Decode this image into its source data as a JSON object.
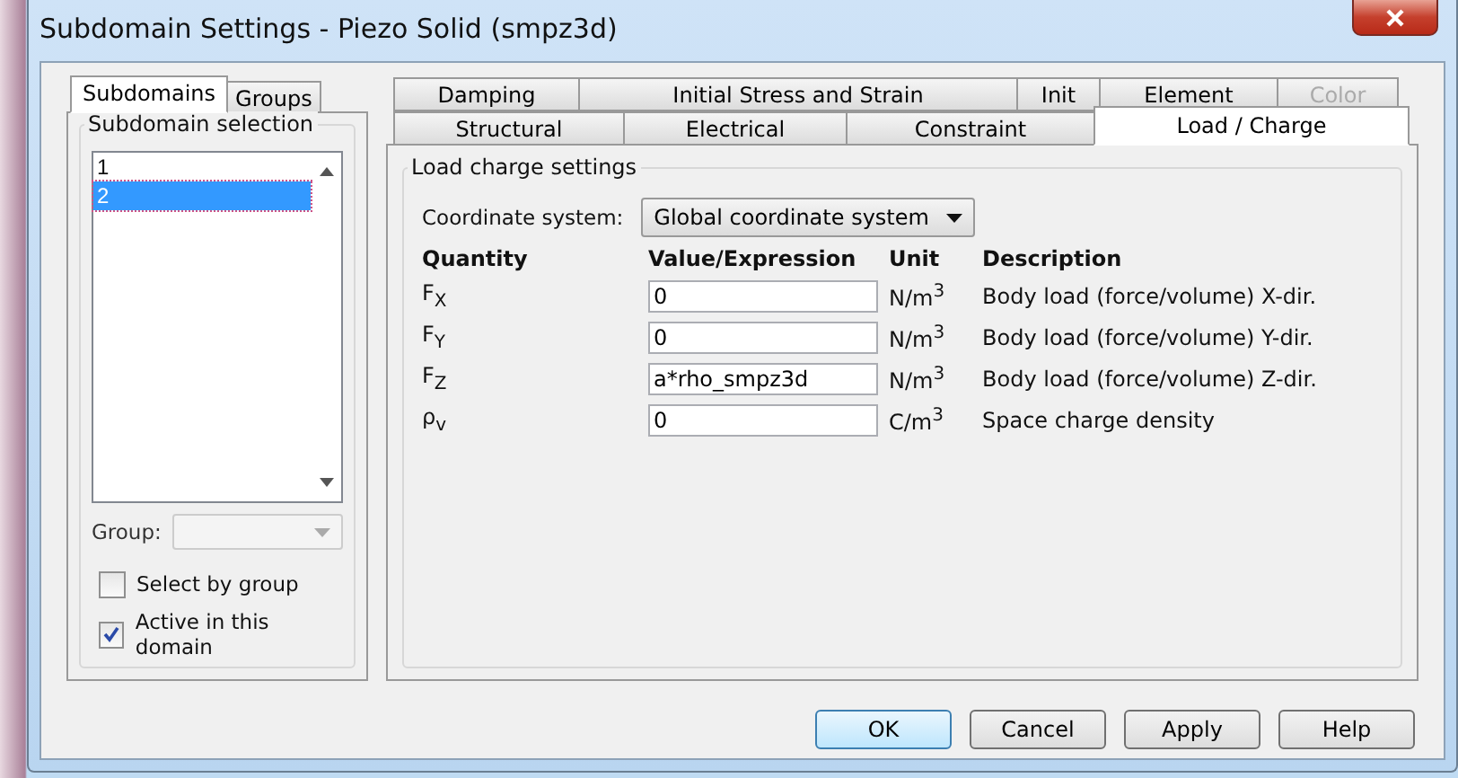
{
  "window": {
    "title": "Subdomain Settings - Piezo Solid (smpz3d)"
  },
  "left_tabs": [
    {
      "label": "Subdomains",
      "selected": true
    },
    {
      "label": "Groups",
      "selected": false
    }
  ],
  "subdomain_selection": {
    "title": "Subdomain selection",
    "items": [
      {
        "label": "1",
        "selected": false
      },
      {
        "label": "2",
        "selected": true
      }
    ]
  },
  "group": {
    "label": "Group:",
    "disabled": true
  },
  "checkboxes": [
    {
      "label": "Select by group",
      "checked": false
    },
    {
      "label": "Active in this domain",
      "checked": true
    }
  ],
  "tab_rows": [
    [
      {
        "label": "Damping",
        "selected": false,
        "disabled": false
      },
      {
        "label": "Initial Stress and Strain",
        "selected": false,
        "disabled": false
      },
      {
        "label": "Init",
        "selected": false,
        "disabled": false
      },
      {
        "label": "Element",
        "selected": false,
        "disabled": false
      },
      {
        "label": "Color",
        "selected": false,
        "disabled": true
      }
    ],
    [
      {
        "label": "Structural",
        "selected": false,
        "disabled": false
      },
      {
        "label": "Electrical",
        "selected": false,
        "disabled": false
      },
      {
        "label": "Constraint",
        "selected": false,
        "disabled": false
      },
      {
        "label": "Load / Charge",
        "selected": true,
        "disabled": false
      }
    ]
  ],
  "settings": {
    "title": "Load charge settings",
    "coordinate_label": "Coordinate system:",
    "coordinate_value": "Global coordinate system",
    "columns": [
      "Quantity",
      "Value/Expression",
      "Unit",
      "Description"
    ],
    "rows": [
      {
        "quantity": "F$_{X}$",
        "value": "0",
        "unit": "N/m$^{3}$",
        "description": "Body load (force/volume) X-dir."
      },
      {
        "quantity": "F$_{Y}$",
        "value": "0",
        "unit": "N/m$^{3}$",
        "description": "Body load (force/volume) Y-dir."
      },
      {
        "quantity": "F$_{Z}$",
        "value": "a*rho_smpz3d",
        "unit": "N/m$^{3}$",
        "description": "Body load (force/volume) Z-dir."
      },
      {
        "quantity": "ρ$_{v}$",
        "value": "0",
        "unit": "C/m$^{3}$",
        "description": "Space charge density"
      }
    ]
  },
  "buttons": [
    {
      "label": "OK",
      "default": true
    },
    {
      "label": "Cancel",
      "default": false
    },
    {
      "label": "Apply",
      "default": false
    },
    {
      "label": "Help",
      "default": false
    }
  ]
}
